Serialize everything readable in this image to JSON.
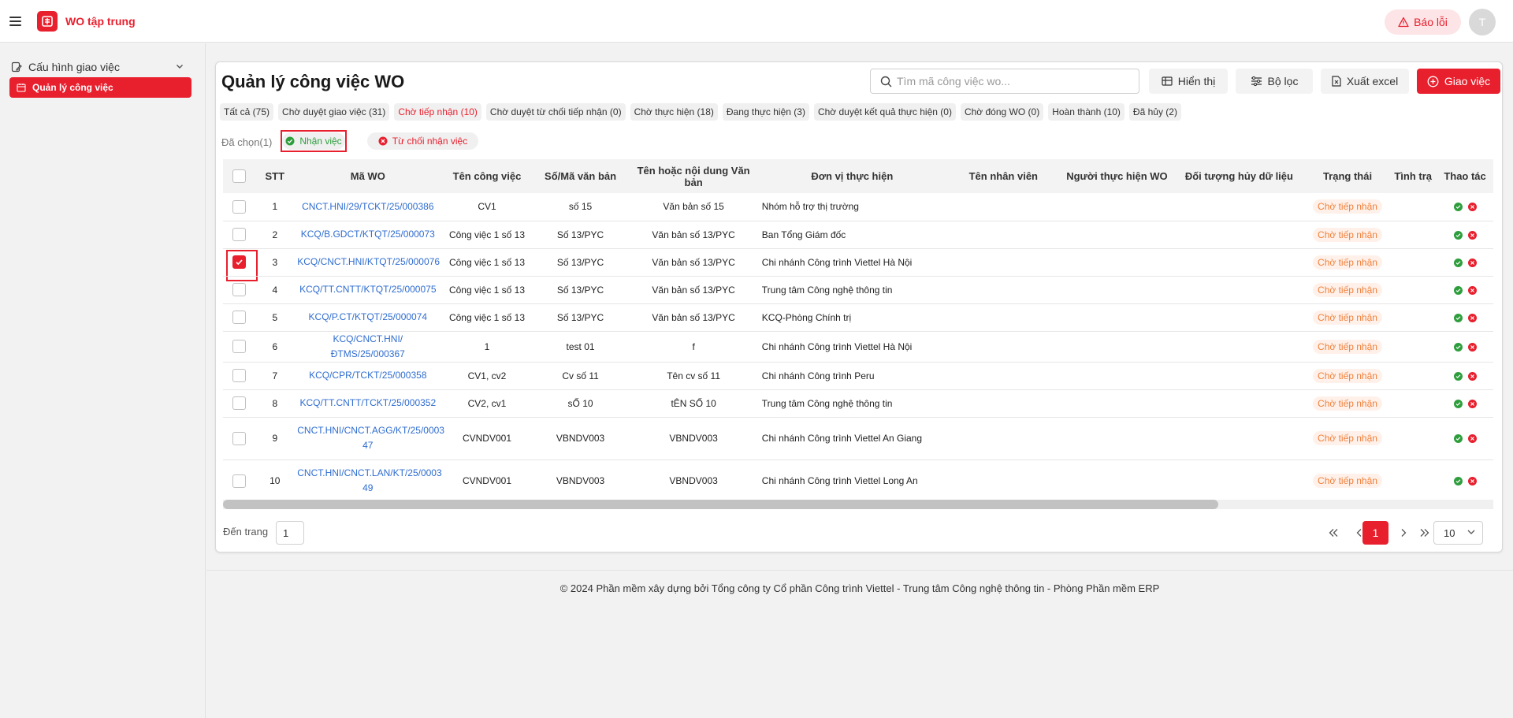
{
  "header": {
    "app_title": "WO tập trung",
    "logo_icon": "viettel-logo-icon",
    "report_label": "Báo lỗi",
    "avatar_initial": "T"
  },
  "sidebar": {
    "group": {
      "label": "Cấu hình giao việc",
      "icon": "settings-edit-icon"
    },
    "active_item": {
      "label": "Quản lý công việc",
      "icon": "calendar-icon"
    }
  },
  "page": {
    "title": "Quản lý công việc WO",
    "search_placeholder": "Tìm mã công việc wo...",
    "buttons": {
      "display": "Hiển thị",
      "filter": "Bộ lọc",
      "export": "Xuất excel",
      "assign": "Giao việc"
    }
  },
  "tabs": [
    "Tất cả (75)",
    "Chờ duyệt giao việc (31)",
    "Chờ tiếp nhận (10)",
    "Chờ duyệt từ chối tiếp nhận (0)",
    "Chờ thực hiện (18)",
    "Đang thực hiện (3)",
    "Chờ duyệt kết quả thực hiện (0)",
    "Chờ đóng WO (0)",
    "Hoàn thành (10)",
    "Đã hủy (2)"
  ],
  "active_tab_index": 2,
  "selection": {
    "count_label": "Đã chọn(1)",
    "accept_label": "Nhận việc",
    "reject_label": "Từ chối nhận việc"
  },
  "table": {
    "columns": [
      "STT",
      "Mã WO",
      "Tên công việc",
      "Số/Mã văn bản",
      "Tên hoặc nội dung Văn bản",
      "Đơn vị thực hiện",
      "Tên nhân viên",
      "Người thực hiện WO",
      "Đối tượng hủy dữ liệu",
      "Trạng thái",
      "Tình trạ",
      "Thao tác"
    ],
    "rows": [
      {
        "stt": "1",
        "code": "CNCT.HNI/29/TCKT/25/000386",
        "name": "CV1",
        "doc_no": "số 15",
        "doc_name": "Văn bản số 15",
        "unit": "Nhóm hỗ trợ thị trường",
        "status": "Chờ tiếp nhận",
        "checked": false
      },
      {
        "stt": "2",
        "code": "KCQ/B.GDCT/KTQT/25/000073",
        "name": "Công việc 1 số 13",
        "doc_no": "Số 13/PYC",
        "doc_name": "Văn bản số 13/PYC",
        "unit": "Ban Tổng Giám đốc",
        "status": "Chờ tiếp nhận",
        "checked": false
      },
      {
        "stt": "3",
        "code": "KCQ/CNCT.HNI/KTQT/25/000076",
        "name": "Công việc 1 số 13",
        "doc_no": "Số 13/PYC",
        "doc_name": "Văn bản số 13/PYC",
        "unit": "Chi nhánh Công trình Viettel Hà Nội",
        "status": "Chờ tiếp nhận",
        "checked": true
      },
      {
        "stt": "4",
        "code": "KCQ/TT.CNTT/KTQT/25/000075",
        "name": "Công việc 1 số 13",
        "doc_no": "Số 13/PYC",
        "doc_name": "Văn bản số 13/PYC",
        "unit": "Trung tâm Công nghệ thông tin",
        "status": "Chờ tiếp nhận",
        "checked": false
      },
      {
        "stt": "5",
        "code": "KCQ/P.CT/KTQT/25/000074",
        "name": "Công việc 1 số 13",
        "doc_no": "Số 13/PYC",
        "doc_name": "Văn bản số 13/PYC",
        "unit": "KCQ-Phòng Chính trị",
        "status": "Chờ tiếp nhận",
        "checked": false
      },
      {
        "stt": "6",
        "code": "KCQ/CNCT.HNI/ĐTMS/25/000367",
        "name": "1",
        "doc_no": "test 01",
        "doc_name": "f",
        "unit": "Chi nhánh Công trình Viettel Hà Nội",
        "status": "Chờ tiếp nhận",
        "checked": false
      },
      {
        "stt": "7",
        "code": "KCQ/CPR/TCKT/25/000358",
        "name": "CV1, cv2",
        "doc_no": "Cv số 11",
        "doc_name": "Tên cv số 11",
        "unit": "Chi nhánh Công trình Peru",
        "status": "Chờ tiếp nhận",
        "checked": false
      },
      {
        "stt": "8",
        "code": "KCQ/TT.CNTT/TCKT/25/000352",
        "name": "CV2, cv1",
        "doc_no": "sỐ 10",
        "doc_name": "tÊN SỐ 10",
        "unit": "Trung tâm Công nghệ thông tin",
        "status": "Chờ tiếp nhận",
        "checked": false
      },
      {
        "stt": "9",
        "code": "CNCT.HNI/CNCT.AGG/KT/25/000347",
        "code_lines": [
          "CNCT.HNI/CNCT.AGG/KT/25/0003",
          "47"
        ],
        "name": "CVNDV001",
        "doc_no": "VBNDV003",
        "doc_name": "VBNDV003",
        "unit": "Chi nhánh Công trình Viettel An Giang",
        "status": "Chờ tiếp nhận",
        "checked": false
      },
      {
        "stt": "10",
        "code": "CNCT.HNI/CNCT.LAN/KT/25/000349",
        "code_lines": [
          "CNCT.HNI/CNCT.LAN/KT/25/0003",
          "49"
        ],
        "name": "CVNDV001",
        "doc_no": "VBNDV003",
        "doc_name": "VBNDV003",
        "unit": "Chi nhánh Công trình Viettel Long An",
        "status": "Chờ tiếp nhận",
        "checked": false
      }
    ]
  },
  "pagination": {
    "goto_label": "Đến trang",
    "goto_value": "1",
    "current_page": "1",
    "page_size": "10"
  },
  "footer": "© 2024 Phần mềm xây dựng bởi Tổng công ty Cổ phần Công trình Viettel - Trung tâm Công nghệ thông tin - Phòng Phần mềm ERP",
  "colors": {
    "brand": "#e8202e",
    "link": "#2f6dd0",
    "status": "#f0803a",
    "accept": "#2e9e3d"
  }
}
